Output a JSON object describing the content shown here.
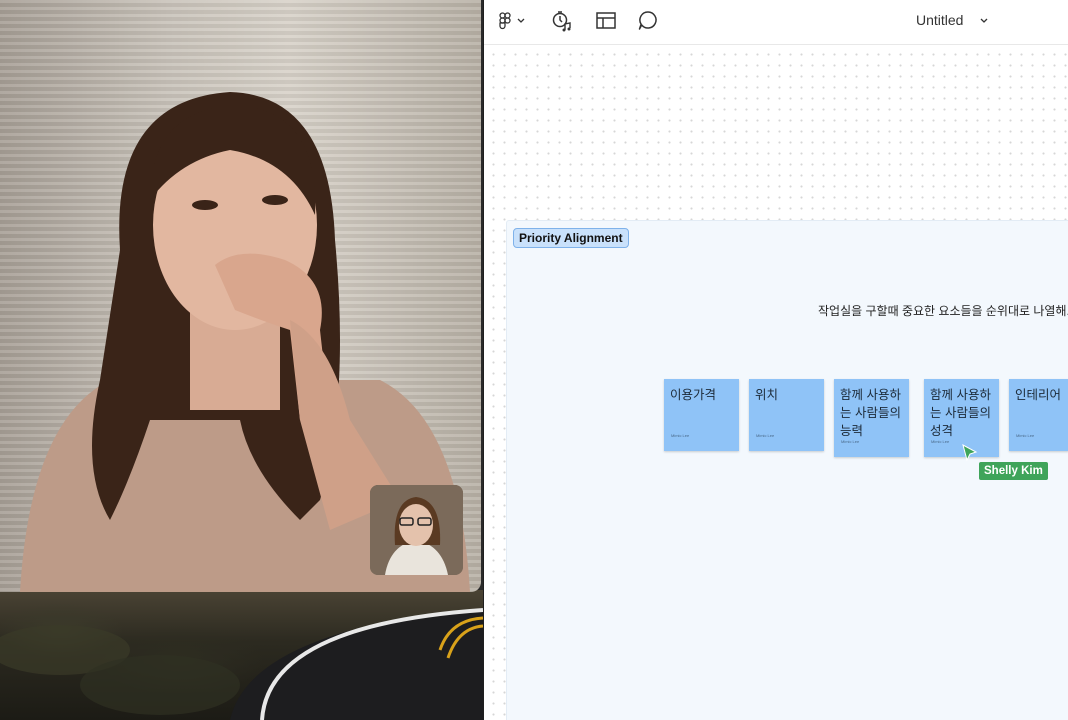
{
  "toolbar": {
    "document_title": "Untitled",
    "icons": [
      "figma-logo-icon",
      "chevron-down-icon",
      "timer-music-icon",
      "layout-icon",
      "comment-icon"
    ]
  },
  "board": {
    "section_label": "Priority Alignment",
    "prompt": "작업실을 구할때 중요한 요소들을 순위대로 나열해.",
    "stickies": [
      {
        "text": "이용가격",
        "author": "Mimic Lee"
      },
      {
        "text": "위치",
        "author": "Mimic Lee"
      },
      {
        "text": "함께 사용하는 사람들의 능력",
        "author": "Mimic Lee"
      },
      {
        "text": "함께 사용하는 사람들의 성격",
        "author": "Mimic Lee"
      },
      {
        "text": "인테리어",
        "author": "Mimic Lee"
      }
    ],
    "colors": {
      "sticky": "#8fc3f7",
      "section_label_bg": "#c9e1fb",
      "cursor": "#3fa45a"
    }
  },
  "collaborator_cursor": {
    "name": "Shelly Kim"
  }
}
